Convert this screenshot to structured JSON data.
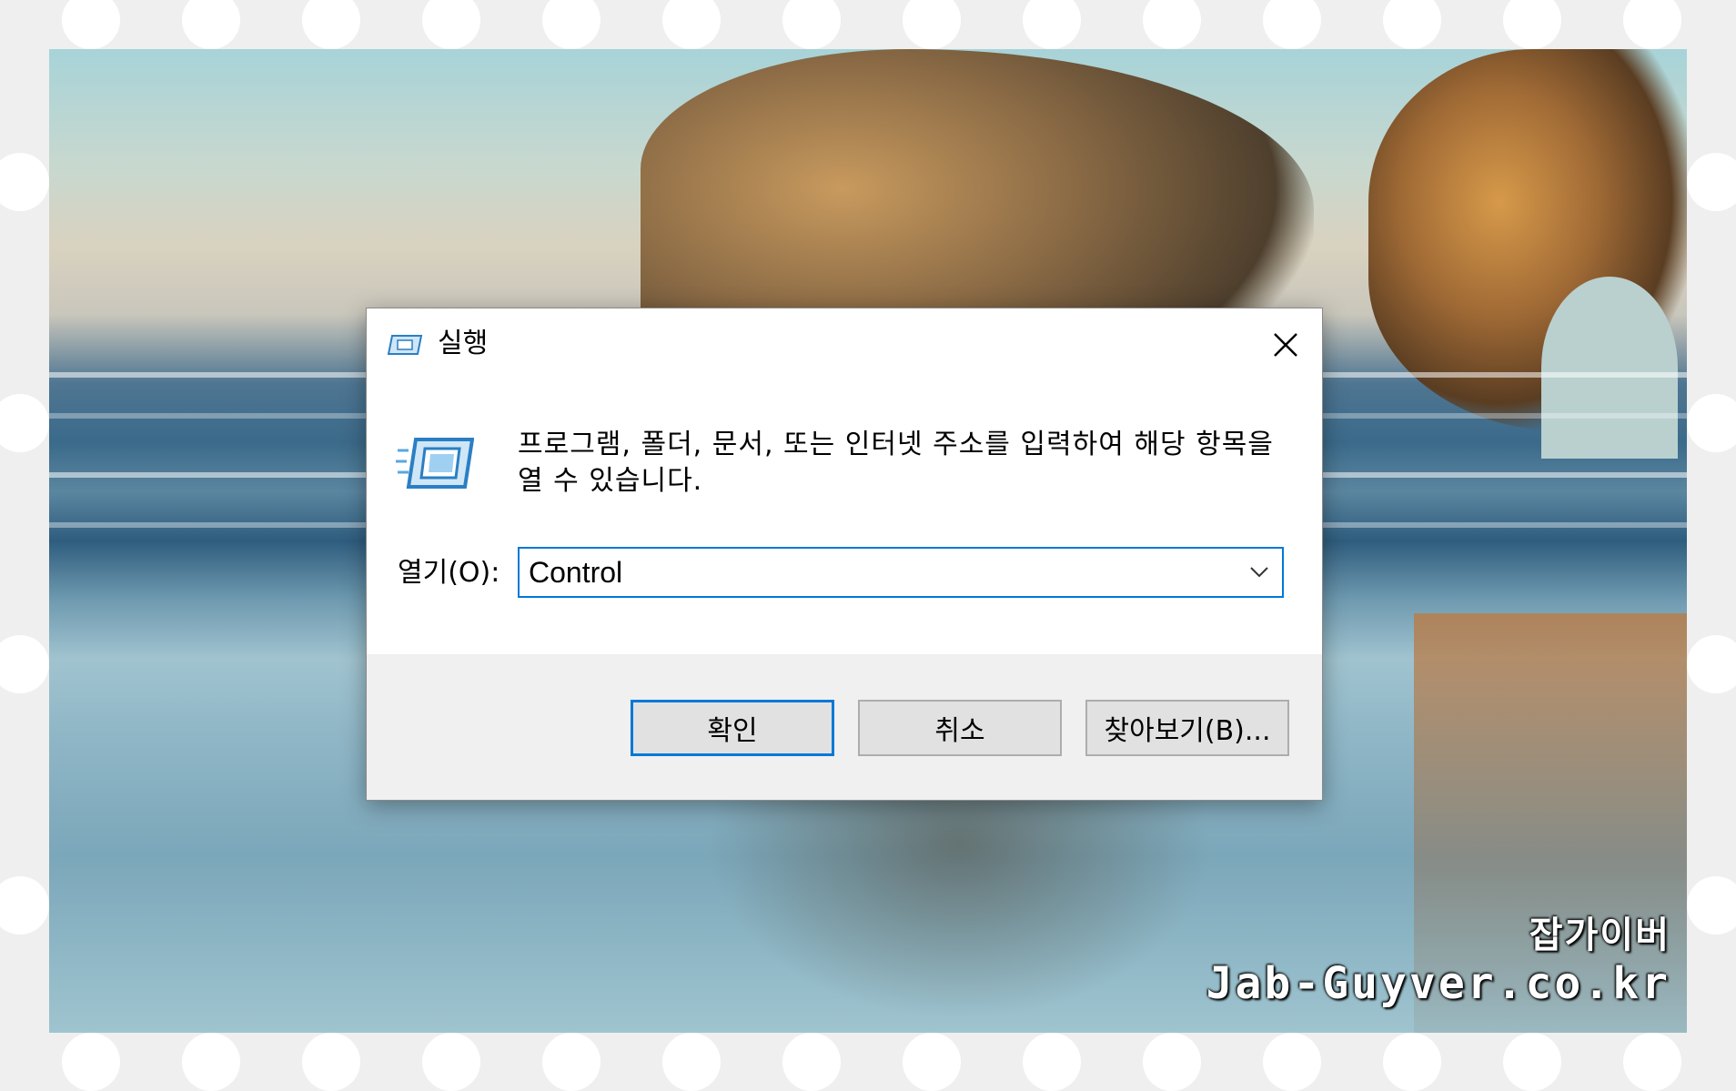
{
  "dialog": {
    "title": "실행",
    "description": "프로그램, 폴더, 문서, 또는 인터넷 주소를 입력하여 해당 항목을 열 수 있습니다.",
    "open_label": "열기(O):",
    "open_value": "Control",
    "buttons": {
      "ok": "확인",
      "cancel": "취소",
      "browse": "찾아보기(B)..."
    },
    "icons": {
      "title_icon": "run-icon",
      "big_icon": "run-icon",
      "close_icon": "close-icon",
      "dropdown_icon": "chevron-down-icon"
    },
    "accent_color": "#0078d7"
  },
  "watermark": {
    "korean": "잡가이버",
    "url": "Jab-Guyver.co.kr"
  }
}
